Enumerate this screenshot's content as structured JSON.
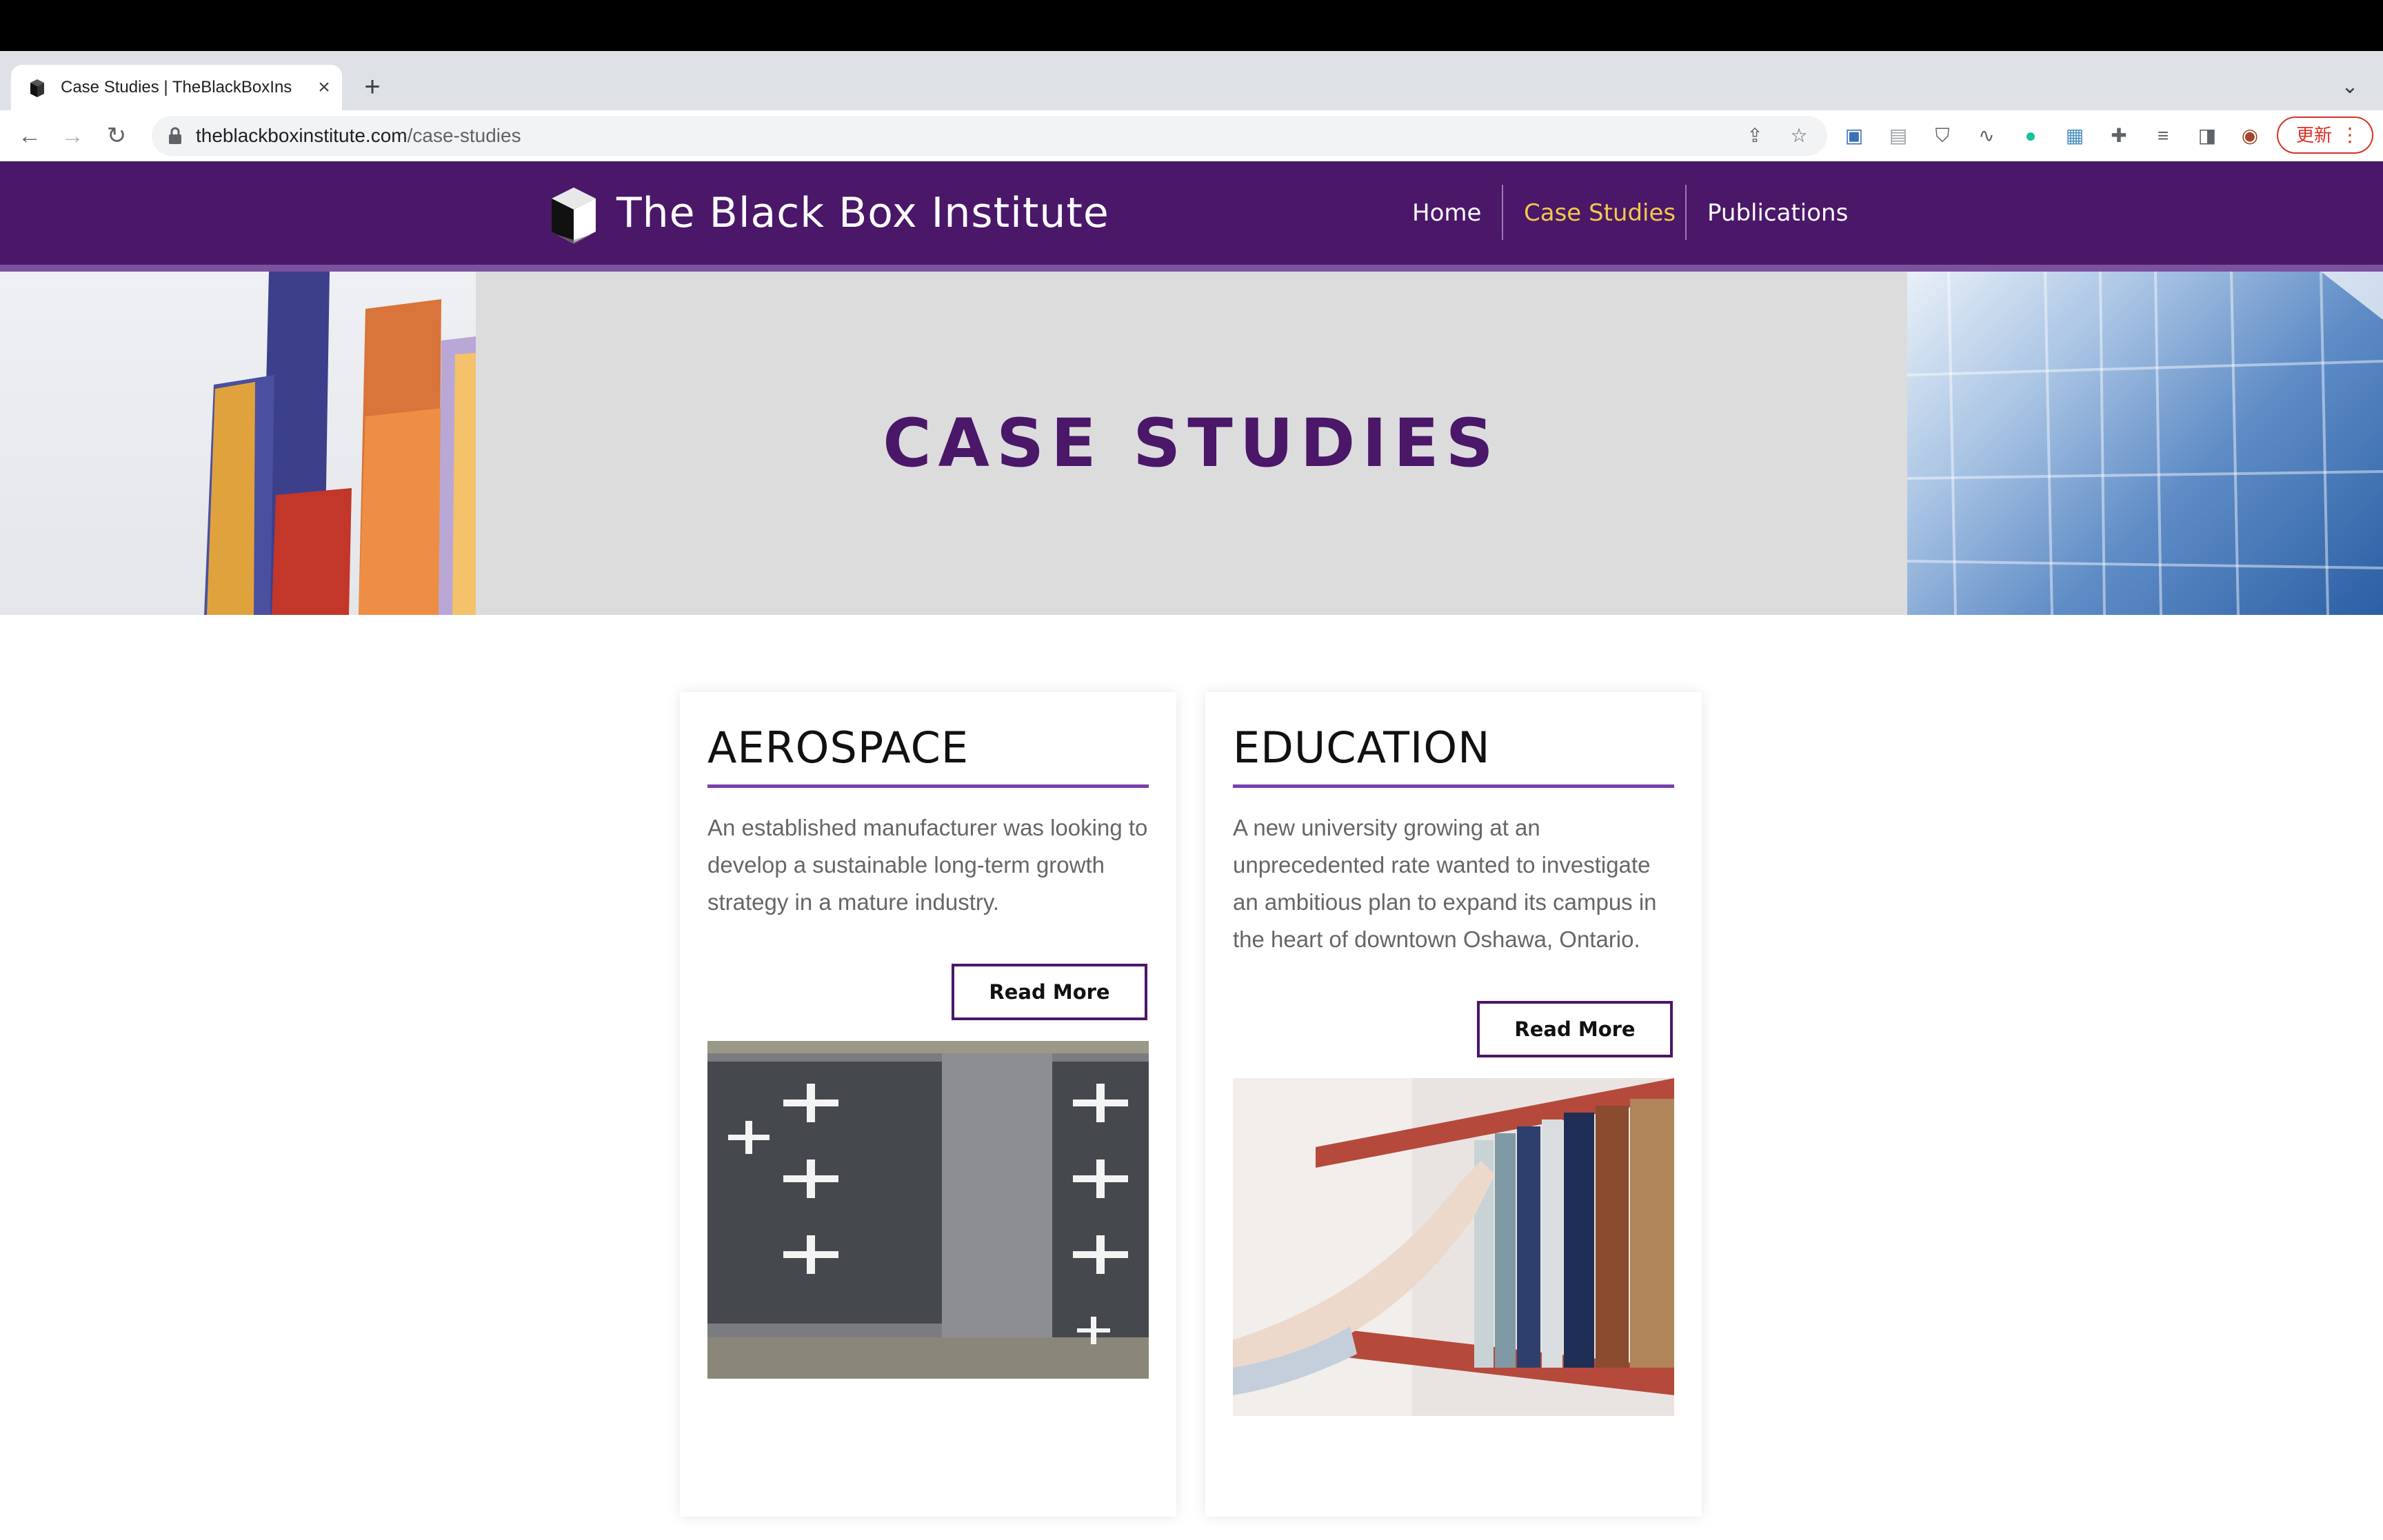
{
  "browser": {
    "tab_title": "Case Studies | TheBlackBoxIns",
    "url_host": "theblackboxinstitute.com",
    "url_path": "/case-studies",
    "update_label": "更新",
    "icons": [
      "back-icon",
      "forward-icon",
      "reload-icon",
      "lock-icon",
      "share-icon",
      "star-icon",
      "extension-icon",
      "puzzle-icon",
      "reading-list-icon",
      "side-panel-icon",
      "profile-avatar"
    ]
  },
  "site": {
    "name": "The Black Box Institute",
    "nav": [
      {
        "label": "Home",
        "active": false
      },
      {
        "label": "Case Studies",
        "active": true
      },
      {
        "label": "Publications",
        "active": false
      }
    ],
    "colors": {
      "brand": "#4a1769",
      "accent": "#7b3fae",
      "nav_active": "#f2c94c"
    }
  },
  "hero": {
    "title": "CASE STUDIES"
  },
  "cards": [
    {
      "title": "AEROSPACE",
      "text": "An established manufacturer was looking to develop a sustainable long-term growth strategy in a mature industry.",
      "button": "Read More"
    },
    {
      "title": "EDUCATION",
      "text": "A new university growing at an unprecedented rate wanted to investigate an ambitious plan to expand its campus in the heart of downtown Oshawa, Ontario.",
      "button": "Read More"
    }
  ]
}
